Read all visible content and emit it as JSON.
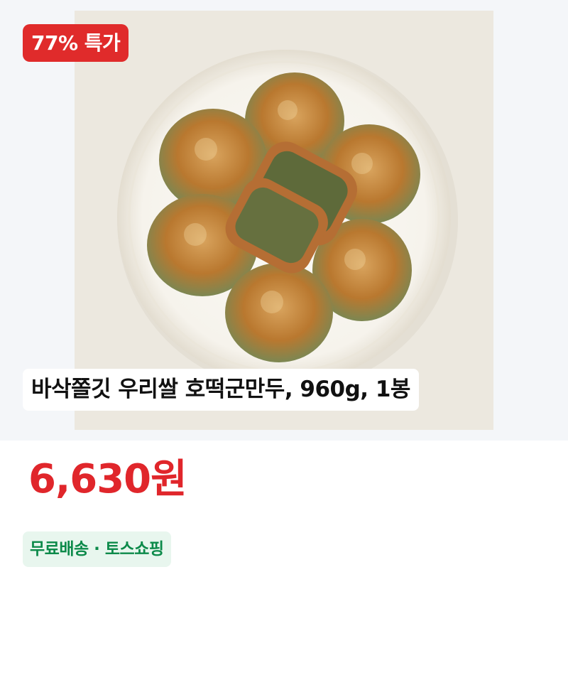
{
  "product": {
    "badge": "77% 특가",
    "title": "바삭쫄깃 우리쌀 호떡군만두, 960g, 1봉",
    "price": "6,630원",
    "shipping": "무료배송 · 토스쇼핑",
    "image_alt": "호떡군만두 접시 사진"
  },
  "colors": {
    "accent_red": "#e0262b",
    "ship_green": "#0c8a4a",
    "ship_bg": "#e8f6ee"
  }
}
